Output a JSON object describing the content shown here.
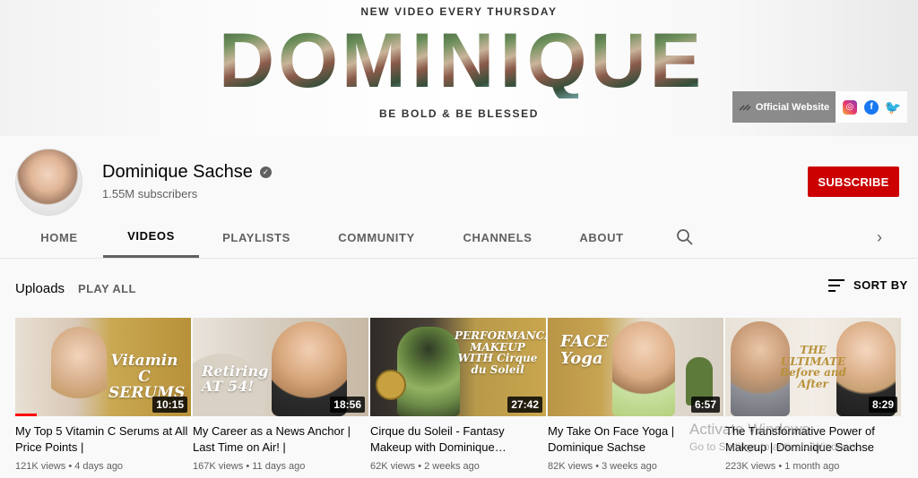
{
  "banner": {
    "tagline_top": "NEW VIDEO EVERY THURSDAY",
    "letters": [
      "D",
      "O",
      "M",
      "I",
      "N",
      "I",
      "Q",
      "U",
      "E"
    ],
    "tagline_bottom": "BE BOLD & BE BLESSED",
    "website_label": "Official Website",
    "social": {
      "instagram": "◎",
      "facebook": "f",
      "twitter": "🐦"
    }
  },
  "channel": {
    "name": "Dominique Sachse",
    "verified_glyph": "✓",
    "subscribers": "1.55M subscribers",
    "subscribe_label": "SUBSCRIBE"
  },
  "tabs": [
    "HOME",
    "VIDEOS",
    "PLAYLISTS",
    "COMMUNITY",
    "CHANNELS",
    "ABOUT"
  ],
  "active_tab": "VIDEOS",
  "tab_next_glyph": "›",
  "uploads": {
    "title": "Uploads",
    "play_all": "PLAY ALL",
    "sort_by": "SORT BY"
  },
  "videos": [
    {
      "title": "My Top 5 Vitamin C Serums at All Price Points |",
      "views": "121K views",
      "age": "4 days ago",
      "duration": "10:15",
      "thumb_text": "Vitamin C SERUMS",
      "watched": 0.12
    },
    {
      "title": "My Career as a News Anchor | Last Time on Air! |",
      "views": "167K views",
      "age": "11 days ago",
      "duration": "18:56",
      "thumb_text": "Retiring AT 54!"
    },
    {
      "title": "Cirque du Soleil - Fantasy Makeup with Dominique…",
      "views": "62K views",
      "age": "2 weeks ago",
      "duration": "27:42",
      "thumb_text": "PERFORMANCE MAKEUP WITH Cirque du Soleil"
    },
    {
      "title": "My Take On Face Yoga | Dominique Sachse",
      "views": "82K views",
      "age": "3 weeks ago",
      "duration": "6:57",
      "thumb_text": "FACE Yoga"
    },
    {
      "title": "The Transformative Power of Makeup | Dominique Sachse",
      "views": "223K views",
      "age": "1 month ago",
      "duration": "8:29",
      "thumb_text": "THE ULTIMATE Before and After"
    }
  ],
  "watermark": {
    "line1": "Activate Windows",
    "line2": "Go to Settings to activate Windows."
  }
}
